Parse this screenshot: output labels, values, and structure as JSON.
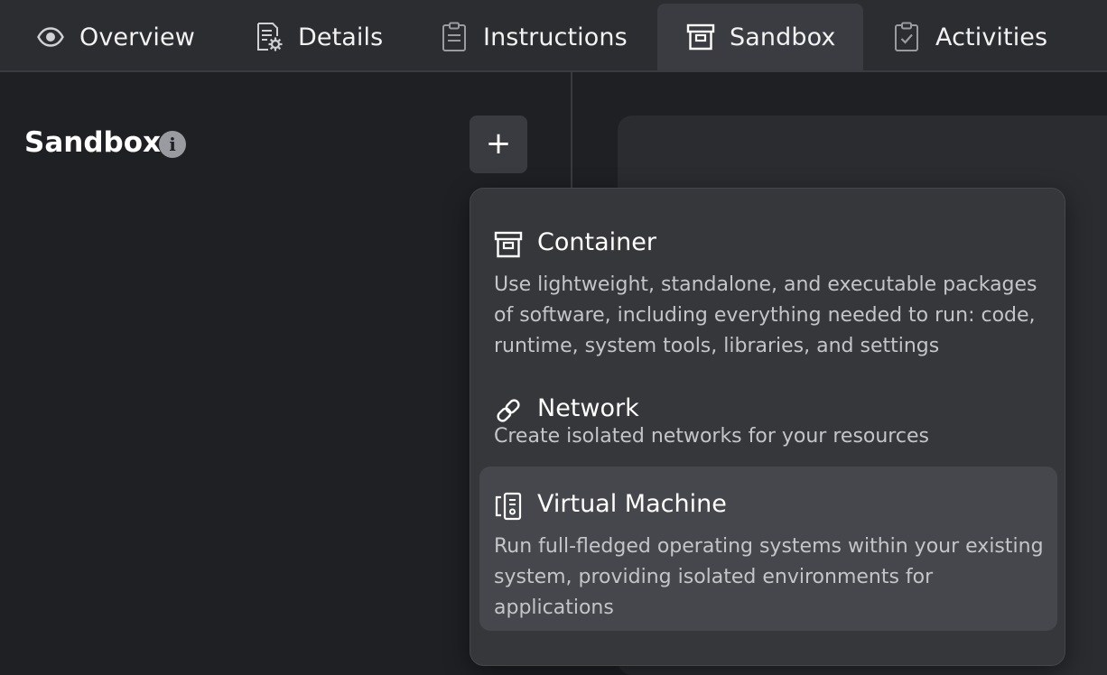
{
  "tabs": [
    {
      "label": "Overview",
      "icon": "eye-icon"
    },
    {
      "label": "Details",
      "icon": "document-gear-icon"
    },
    {
      "label": "Instructions",
      "icon": "clipboard-icon"
    },
    {
      "label": "Sandbox",
      "icon": "archive-box-icon",
      "active": true
    },
    {
      "label": "Activities",
      "icon": "clipboard-check-icon"
    }
  ],
  "sandbox": {
    "title": "Sandbox",
    "info_icon": "info-icon",
    "add_button_label": "+"
  },
  "menu": {
    "items": [
      {
        "title": "Container",
        "icon": "archive-box-icon",
        "description": "Use lightweight, standalone, and executable packages of software, including everything needed to run: code, runtime, system tools, libraries, and settings"
      },
      {
        "title": "Network",
        "icon": "link-icon",
        "description": "Create isolated networks for your resources"
      },
      {
        "title": "Virtual Machine",
        "icon": "server-device-icon",
        "description": "Run full-fledged operating systems within your existing system, providing isolated environments for applications",
        "highlighted": true
      }
    ]
  },
  "colors": {
    "background": "#1f2024",
    "tabbar": "#2c2d31",
    "active_tab": "#3b3c41",
    "menu_bg": "#36373b",
    "menu_highlight": "#46474c",
    "text_primary": "#ffffff",
    "text_secondary": "#c4c5c9"
  }
}
